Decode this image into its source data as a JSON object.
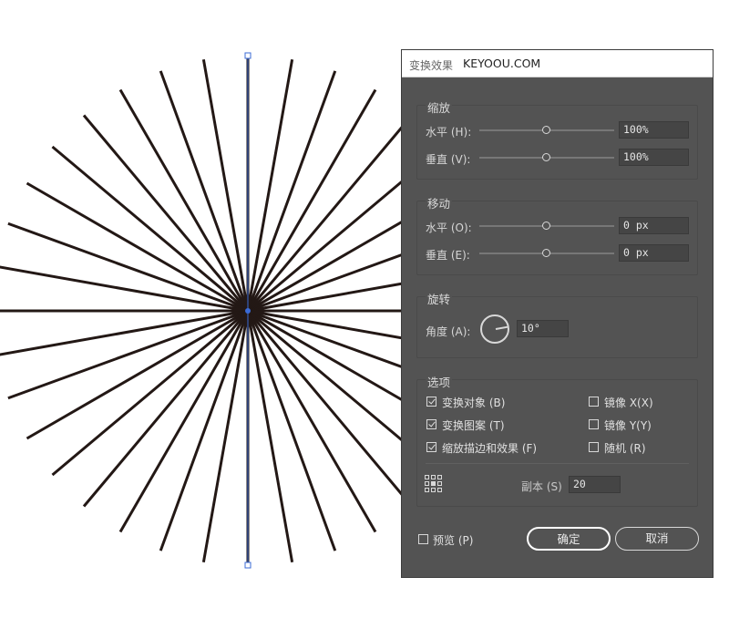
{
  "canvas": {
    "ray_count": 36,
    "ray_color": "#231815",
    "selection_color": "#3b6bd6"
  },
  "dialog": {
    "title": "变换效果",
    "brand": "KEYOOU.COM",
    "scale": {
      "legend": "缩放",
      "horizontal_label": "水平 (H):",
      "horizontal_value": "100%",
      "vertical_label": "垂直 (V):",
      "vertical_value": "100%"
    },
    "move": {
      "legend": "移动",
      "horizontal_label": "水平 (O):",
      "horizontal_value": "0 px",
      "vertical_label": "垂直 (E):",
      "vertical_value": "0 px"
    },
    "rotate": {
      "legend": "旋转",
      "angle_label": "角度 (A):",
      "angle_value": "10°"
    },
    "options": {
      "legend": "选项",
      "transform_objects": {
        "label": "变换对象 (B)",
        "checked": true
      },
      "transform_patterns": {
        "label": "变换图案 (T)",
        "checked": true
      },
      "scale_strokes": {
        "label": "缩放描边和效果 (F)",
        "checked": true
      },
      "reflect_x": {
        "label": "镜像 X(X)",
        "checked": false
      },
      "reflect_y": {
        "label": "镜像 Y(Y)",
        "checked": false
      },
      "random": {
        "label": "随机 (R)",
        "checked": false
      },
      "copies_label": "副本 (S)",
      "copies_value": "20"
    },
    "preview": {
      "label": "预览 (P)",
      "checked": false
    },
    "ok_label": "确定",
    "cancel_label": "取消"
  }
}
